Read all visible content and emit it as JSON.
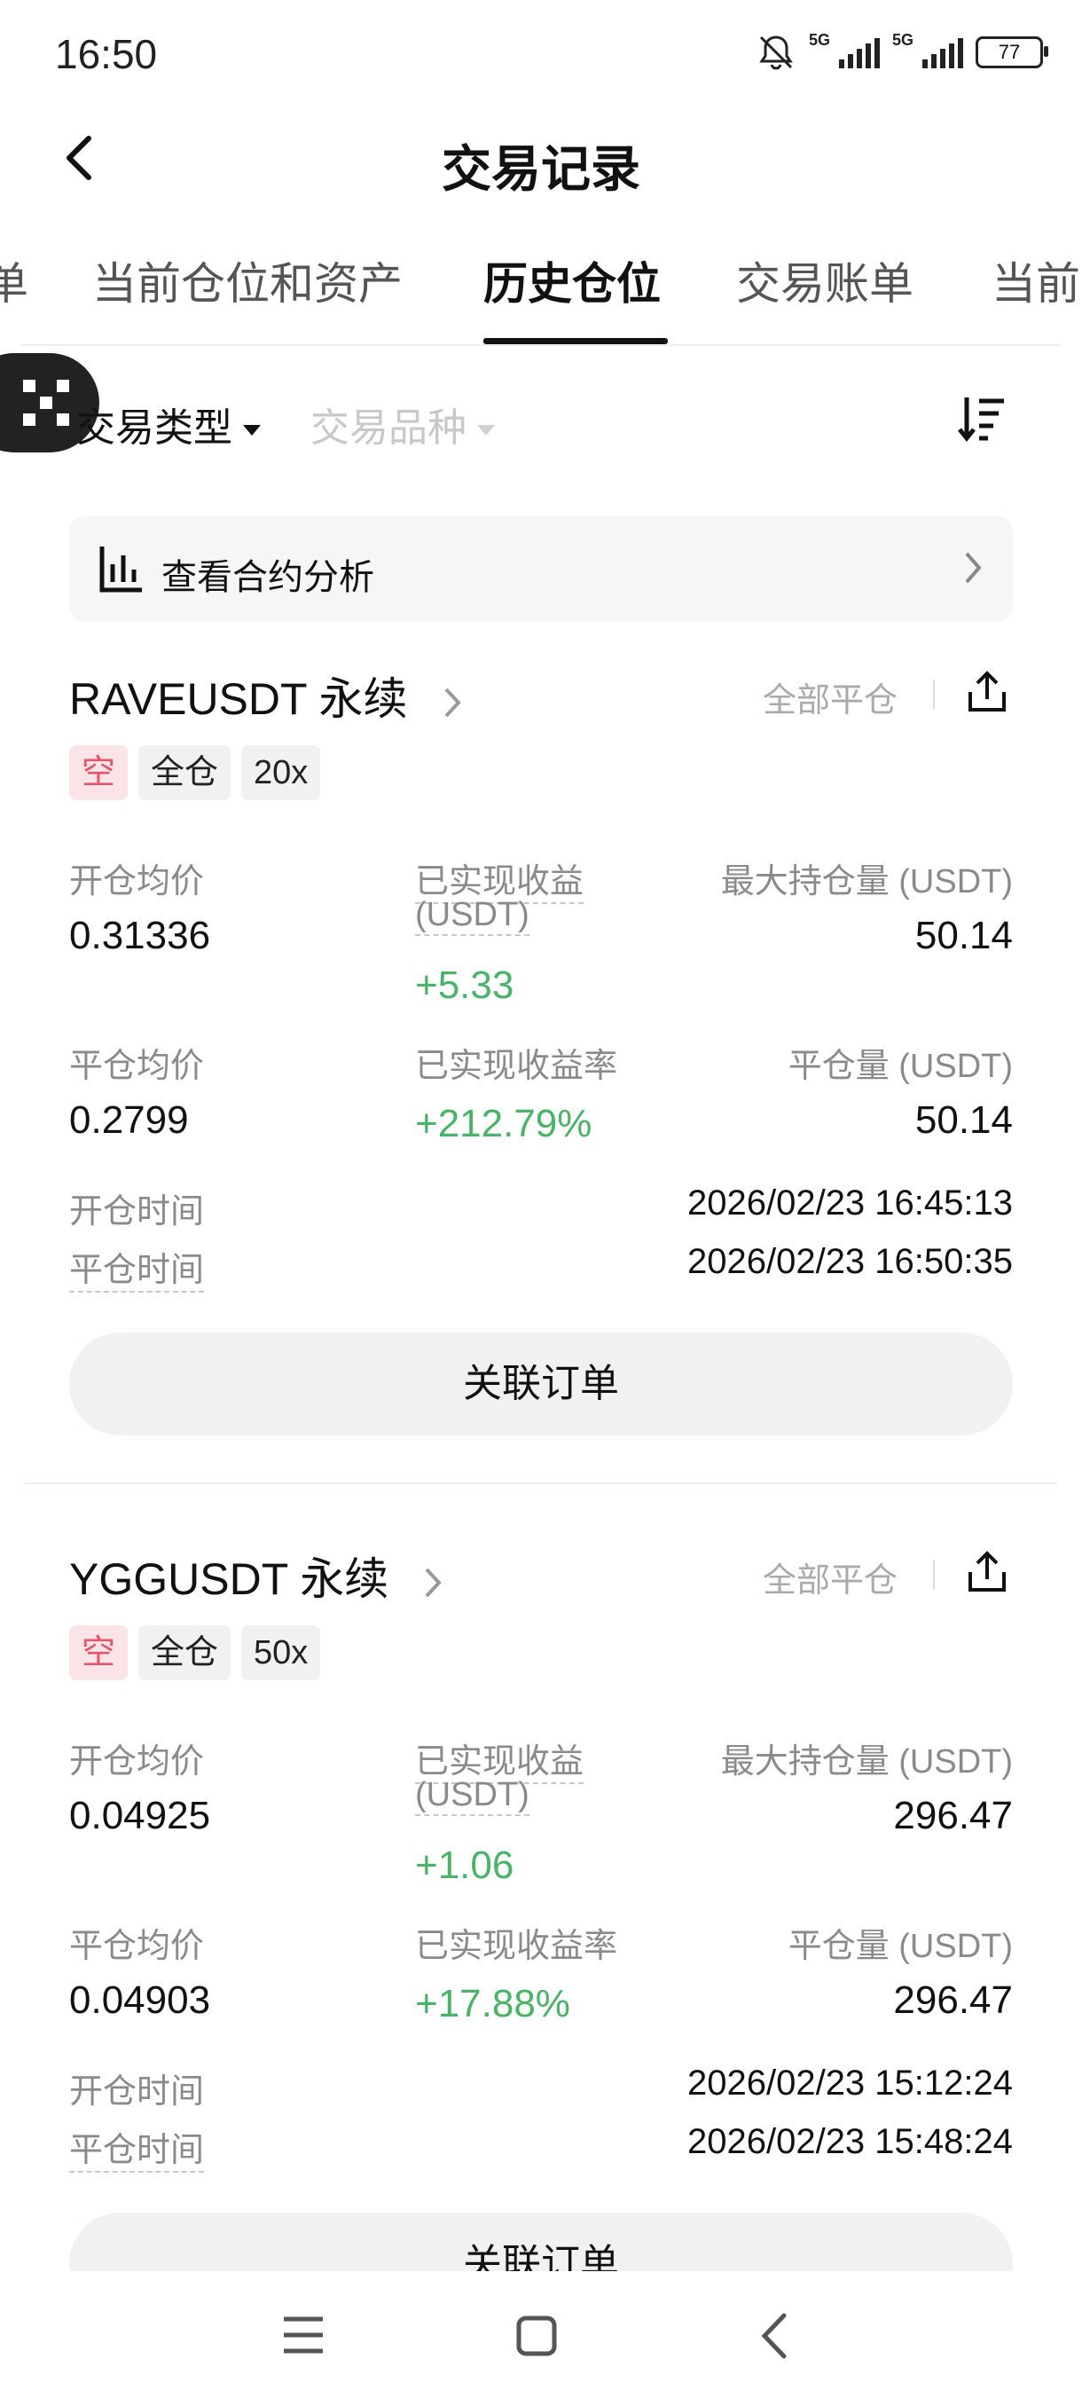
{
  "status_bar": {
    "time": "16:50",
    "network1": "5G",
    "network2": "5G",
    "battery": "77"
  },
  "header": {
    "title": "交易记录"
  },
  "tabs": [
    {
      "label": "单"
    },
    {
      "label": "当前仓位和资产"
    },
    {
      "label": "历史仓位",
      "active": true
    },
    {
      "label": "交易账单"
    },
    {
      "label": "当前"
    }
  ],
  "filters": {
    "trade_type": "交易类型",
    "instrument": "交易品种"
  },
  "analysis": {
    "label": "查看合约分析"
  },
  "positions": [
    {
      "symbol": "RAVEUSDT 永续",
      "close_all": "全部平仓",
      "tags": [
        "空",
        "全仓",
        "20x"
      ],
      "open_avg_label": "开仓均价",
      "open_avg": "0.31336",
      "pnl_label": "已实现收益",
      "pnl_unit": "(USDT)",
      "pnl": "+5.33",
      "max_pos_label": "最大持仓量 (USDT)",
      "max_pos": "50.14",
      "close_avg_label": "平仓均价",
      "close_avg": "0.2799",
      "pnl_rate_label": "已实现收益率",
      "pnl_rate": "+212.79%",
      "close_qty_label": "平仓量 (USDT)",
      "close_qty": "50.14",
      "open_time_label": "开仓时间",
      "open_time": "2026/02/23 16:45:13",
      "close_time_label": "平仓时间",
      "close_time": "2026/02/23 16:50:35",
      "button": "关联订单"
    },
    {
      "symbol": "YGGUSDT 永续",
      "close_all": "全部平仓",
      "tags": [
        "空",
        "全仓",
        "50x"
      ],
      "open_avg_label": "开仓均价",
      "open_avg": "0.04925",
      "pnl_label": "已实现收益",
      "pnl_unit": "(USDT)",
      "pnl": "+1.06",
      "max_pos_label": "最大持仓量 (USDT)",
      "max_pos": "296.47",
      "close_avg_label": "平仓均价",
      "close_avg": "0.04903",
      "pnl_rate_label": "已实现收益率",
      "pnl_rate": "+17.88%",
      "close_qty_label": "平仓量 (USDT)",
      "close_qty": "296.47",
      "open_time_label": "开仓时间",
      "open_time": "2026/02/23 15:12:24",
      "close_time_label": "平仓时间",
      "close_time": "2026/02/23 15:48:24",
      "button": "关联订单"
    }
  ],
  "colors": {
    "profit": "#49b367",
    "short_tag": "#e2566b"
  }
}
